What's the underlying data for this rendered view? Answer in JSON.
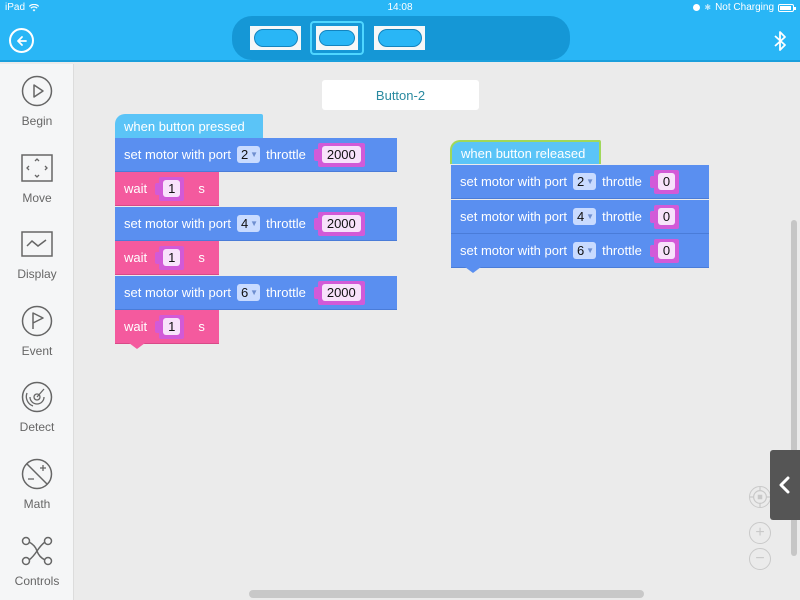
{
  "statusbar": {
    "device": "iPad",
    "time": "14:08",
    "charging": "Not Charging"
  },
  "toolbar": {
    "back_icon": "back-arrow-circle-icon",
    "bluetooth_icon": "bluetooth-icon",
    "tray_buttons": [
      {
        "name": "button-1",
        "selected": false
      },
      {
        "name": "button-2",
        "selected": true
      },
      {
        "name": "button-3",
        "selected": false
      }
    ]
  },
  "sidebar": {
    "items": [
      {
        "label": "Begin",
        "icon": "play-circle-icon"
      },
      {
        "label": "Move",
        "icon": "move-arrows-icon"
      },
      {
        "label": "Display",
        "icon": "display-wave-icon"
      },
      {
        "label": "Event",
        "icon": "flag-circle-icon"
      },
      {
        "label": "Detect",
        "icon": "radar-icon"
      },
      {
        "label": "Math",
        "icon": "math-plus-minus-icon"
      },
      {
        "label": "Controls",
        "icon": "controls-nodes-icon"
      }
    ]
  },
  "canvas": {
    "title": "Button-2",
    "scripts": [
      {
        "hat": "when button pressed",
        "blocks": [
          {
            "type": "motor",
            "prefix": "set motor with port",
            "port": "2",
            "mid": "throttle",
            "value": "2000"
          },
          {
            "type": "wait",
            "prefix": "wait",
            "value": "1",
            "unit": "s"
          },
          {
            "type": "motor",
            "prefix": "set motor with port",
            "port": "4",
            "mid": "throttle",
            "value": "2000"
          },
          {
            "type": "wait",
            "prefix": "wait",
            "value": "1",
            "unit": "s"
          },
          {
            "type": "motor",
            "prefix": "set motor with port",
            "port": "6",
            "mid": "throttle",
            "value": "2000"
          },
          {
            "type": "wait",
            "prefix": "wait",
            "value": "1",
            "unit": "s"
          }
        ]
      },
      {
        "hat": "when button released",
        "blocks": [
          {
            "type": "motor",
            "prefix": "set motor with port",
            "port": "2",
            "mid": "throttle",
            "value": "0"
          },
          {
            "type": "motor",
            "prefix": "set motor with port",
            "port": "4",
            "mid": "throttle",
            "value": "0"
          },
          {
            "type": "motor",
            "prefix": "set motor with port",
            "port": "6",
            "mid": "throttle",
            "value": "0"
          }
        ]
      }
    ]
  },
  "controls": {
    "recenter_icon": "recenter-target-icon",
    "zoom_in": "+",
    "zoom_out": "−",
    "drawer_icon": "chevron-left-icon"
  },
  "colors": {
    "accent": "#29b6f6",
    "hat": "#5bc4f7",
    "motor_block": "#5a8ff0",
    "wait_block": "#f45a9e",
    "value_slot": "#d25ad8"
  }
}
